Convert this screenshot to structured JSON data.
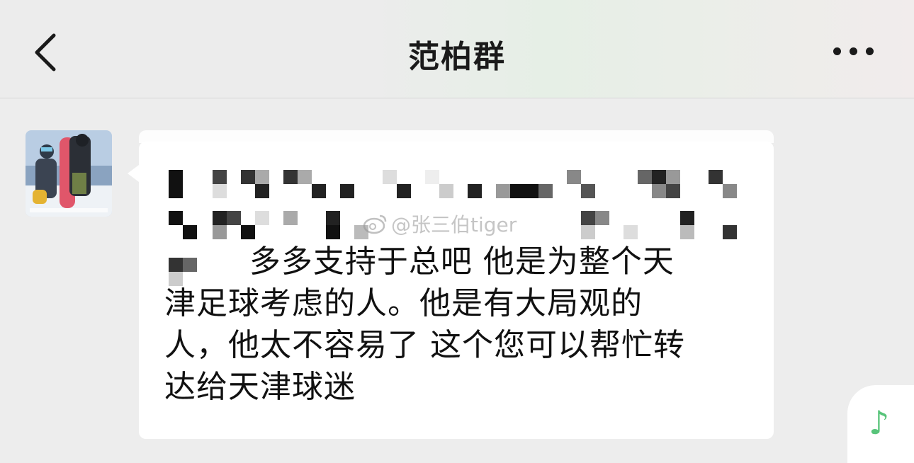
{
  "header": {
    "title": "范柏群"
  },
  "icons": {
    "back": "chevron-left-icon",
    "more": "more-dots-icon",
    "music": "music-note-icon"
  },
  "message": {
    "lines": [
      "        多多支持于总吧 他是为整个天",
      "津足球考虑的人。他是有大局观的",
      "人，他太不容易了 这个您可以帮忙转",
      "达给天津球迷"
    ]
  },
  "watermark": {
    "text": "@张三伯tiger"
  },
  "colors": {
    "accent_green": "#58c47a",
    "bubble": "#ffffff",
    "background": "#ededed"
  }
}
